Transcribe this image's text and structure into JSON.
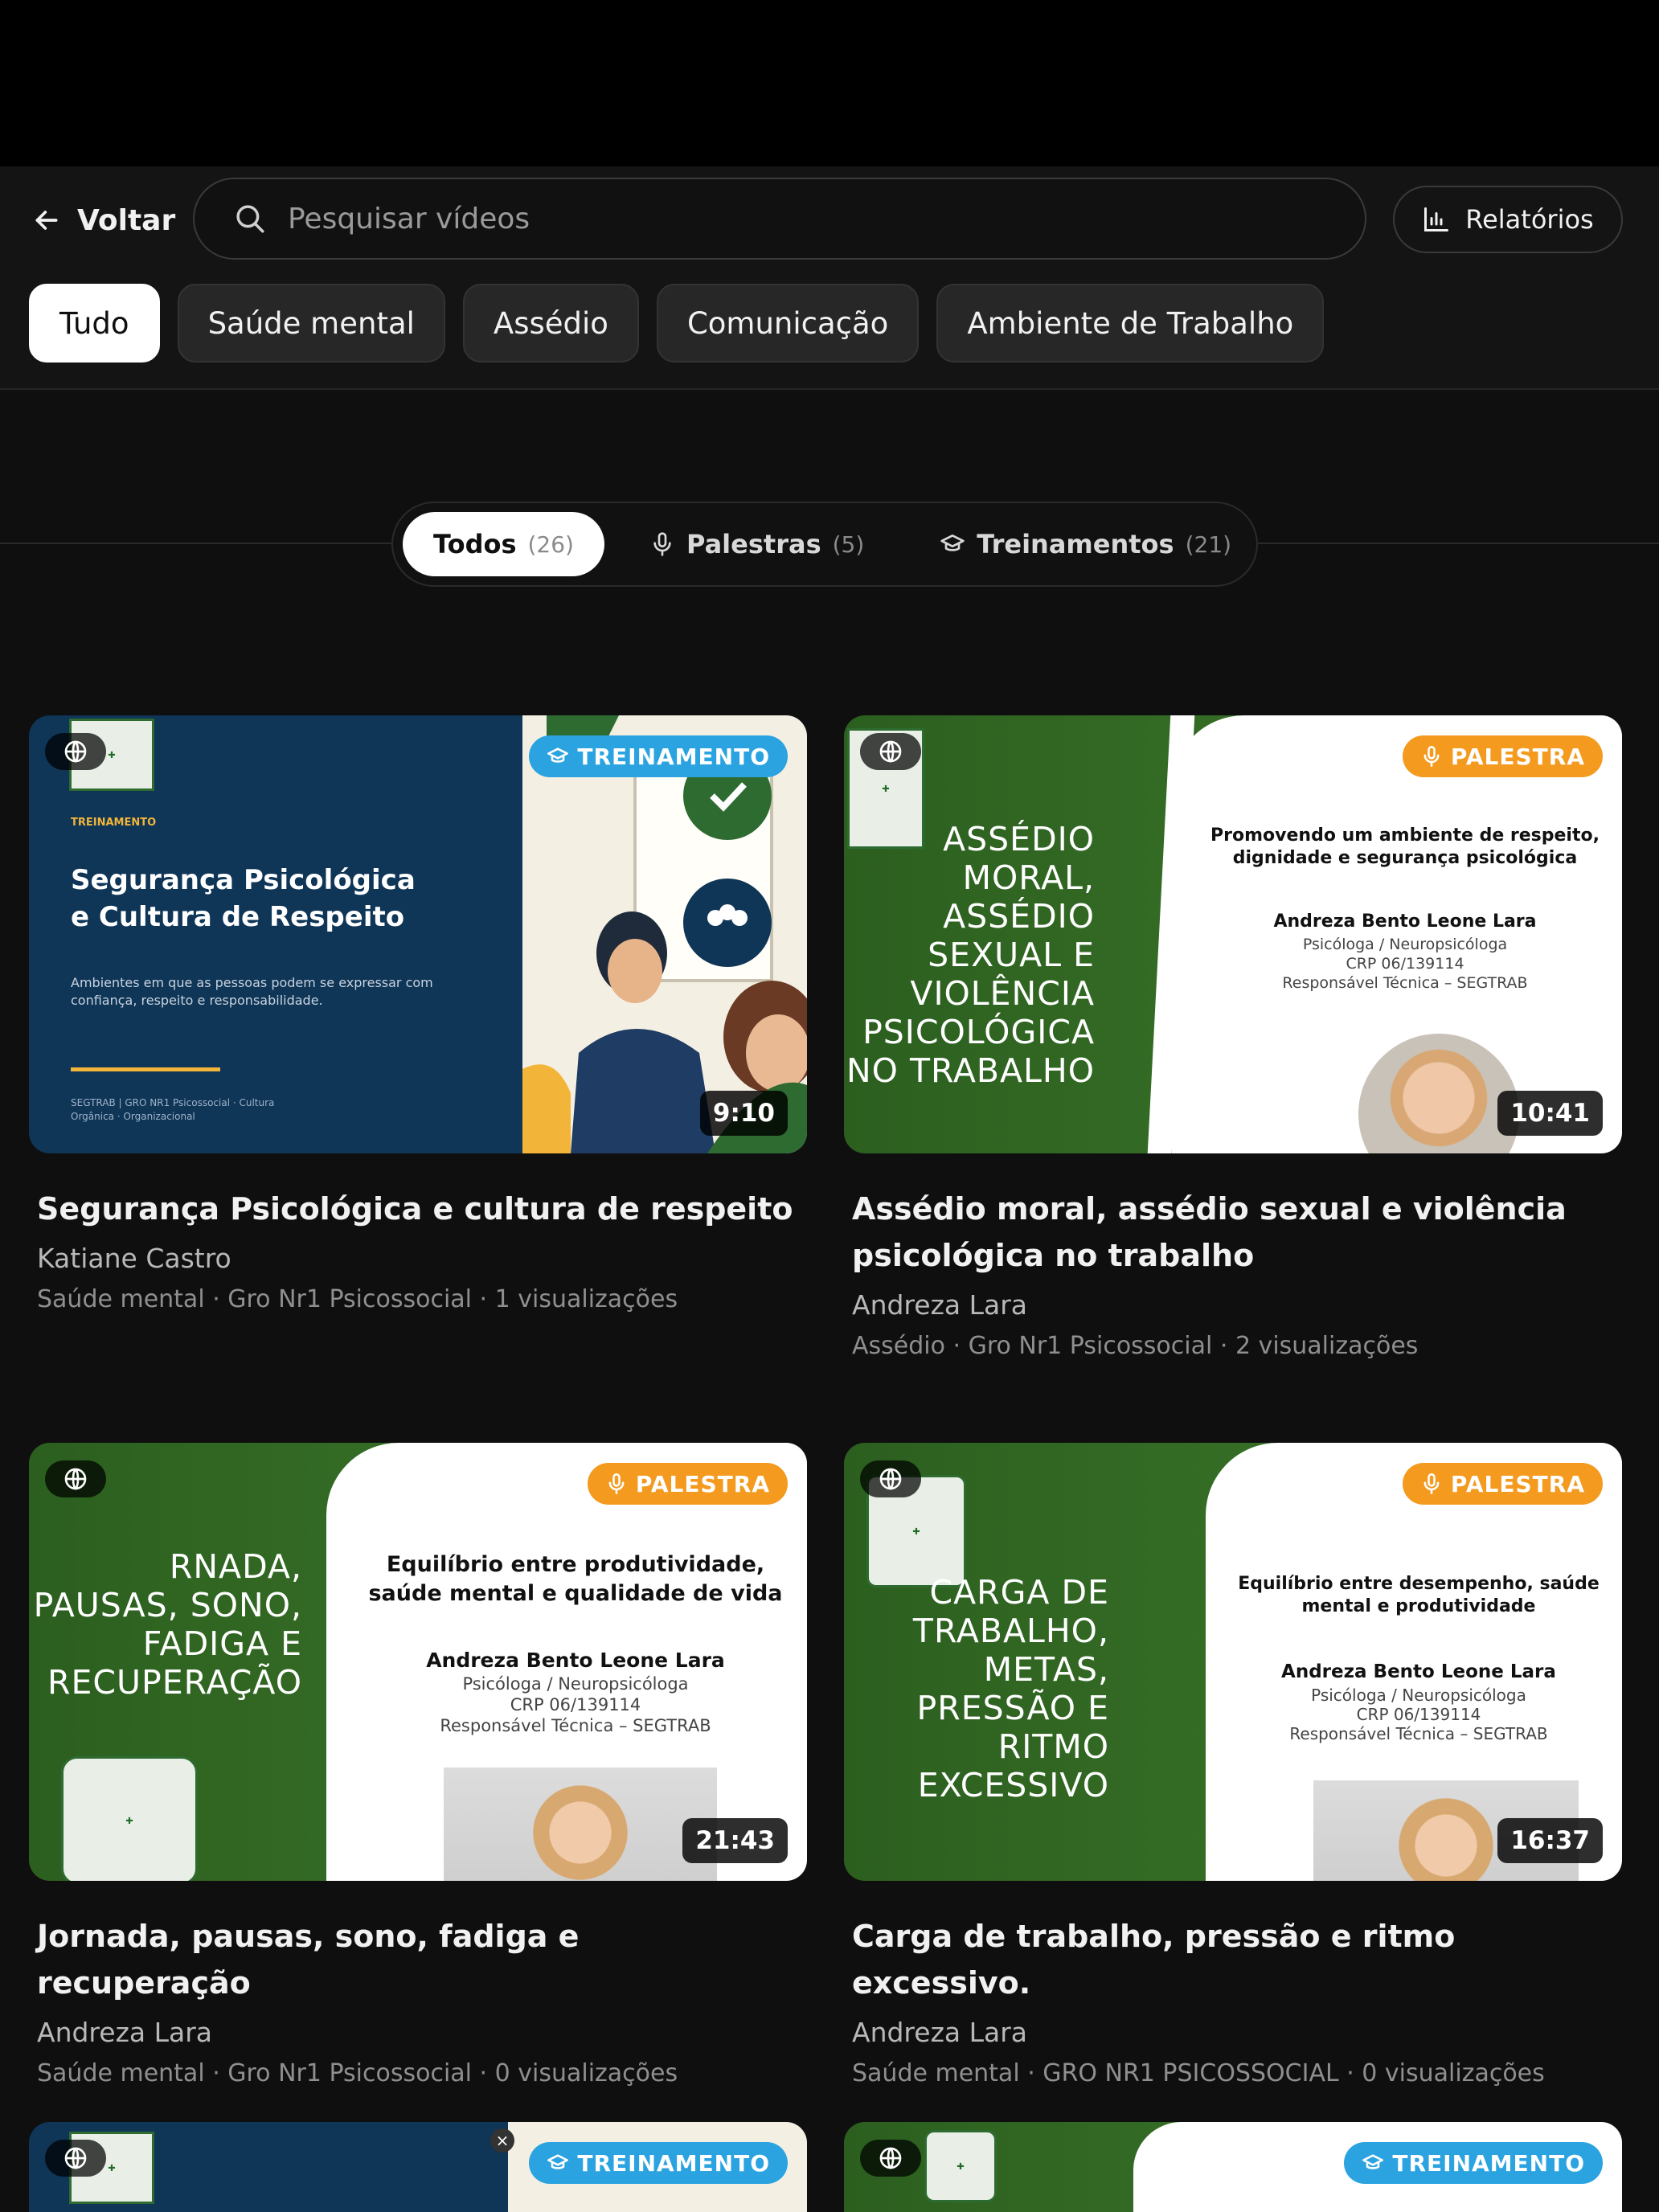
{
  "header": {
    "back_label": "Voltar",
    "search_placeholder": "Pesquisar vídeos",
    "reports_label": "Relatórios"
  },
  "categories": {
    "active": "Tudo",
    "items": [
      "Tudo",
      "Saúde mental",
      "Assédio",
      "Comunicação",
      "Ambiente de Trabalho"
    ]
  },
  "filters": [
    {
      "label": "Todos",
      "count": "(26)",
      "icon": "none",
      "active": true
    },
    {
      "label": "Palestras",
      "count": "(5)",
      "icon": "microphone-icon",
      "active": false
    },
    {
      "label": "Treinamentos",
      "count": "(21)",
      "icon": "graduation-cap-icon",
      "active": false
    }
  ],
  "videos": [
    {
      "badge": "TREINAMENTO",
      "duration": "9:10",
      "title": "Segurança Psicológica e cultura de respeito",
      "author": "Katiane Castro",
      "meta": "Saúde mental · Gro Nr1 Psicossocial · 1 visualizações",
      "slide": {
        "kicker": "TREINAMENTO",
        "heading": "Segurança Psicológica e Cultura de Respeito",
        "subtext": "Ambientes em que as pessoas podem se expressar com confiança, respeito e responsabilidade.",
        "footer": "SEGTRAB | GRO NR1 Psicossocial · Cultura Orgânica · Organizacional"
      }
    },
    {
      "badge": "PALESTRA",
      "duration": "10:41",
      "title": "Assédio moral, assédio sexual e violência psicológica no trabalho",
      "author": "Andreza Lara",
      "meta": "Assédio · Gro Nr1 Psicossocial · 2 visualizações",
      "slide": {
        "left_text": "ASSÉDIO MORAL, ASSÉDIO SEXUAL E VIOLÊNCIA PSICOLÓGICA NO TRABALHO",
        "panel_heading": "Promovendo um ambiente de respeito, dignidade e segurança psicológica",
        "speaker": "Andreza Bento Leone Lara",
        "role": "Psicóloga / Neuropsicóloga",
        "crp": "CRP 06/139114",
        "resp": "Responsável Técnica – SEGTRAB"
      }
    },
    {
      "badge": "PALESTRA",
      "duration": "21:43",
      "title": "Jornada, pausas, sono, fadiga e recuperação",
      "author": "Andreza Lara",
      "meta": "Saúde mental · Gro Nr1 Psicossocial · 0 visualizações",
      "slide": {
        "left_text": "RNADA, PAUSAS, SONO, FADIGA E RECUPERAÇÃO",
        "panel_heading": "Equilíbrio entre produtividade, saúde mental e qualidade de vida",
        "speaker": "Andreza Bento Leone Lara",
        "role": "Psicóloga / Neuropsicóloga",
        "crp": "CRP 06/139114",
        "resp": "Responsável Técnica – SEGTRAB"
      }
    },
    {
      "badge": "PALESTRA",
      "duration": "16:37",
      "title": "Carga de trabalho, pressão e ritmo excessivo.",
      "author": "Andreza Lara",
      "meta": "Saúde mental · GRO NR1 PSICOSSOCIAL · 0 visualizações",
      "slide": {
        "left_text": "CARGA DE TRABALHO, METAS, PRESSÃO E RITMO EXCESSIVO",
        "panel_heading": "Equilíbrio entre desempenho, saúde mental e produtividade",
        "speaker": "Andreza Bento Leone Lara",
        "role": "Psicóloga / Neuropsicóloga",
        "crp": "CRP 06/139114",
        "resp": "Responsável Técnica – SEGTRAB"
      }
    },
    {
      "badge": "TREINAMENTO"
    },
    {
      "badge": "TREINAMENTO"
    }
  ],
  "colors": {
    "background": "#0f0f0f",
    "training_badge": "#2aa3e0",
    "talk_badge": "#f39a1f",
    "slide_navy": "#0f3557",
    "slide_green": "#2c5f1f"
  }
}
